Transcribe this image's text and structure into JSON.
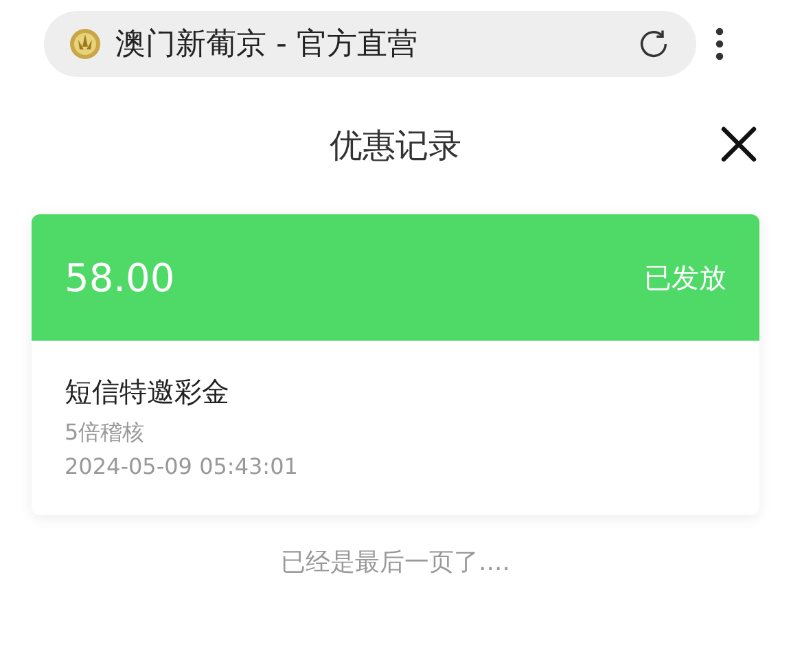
{
  "address_bar": {
    "site_title": "澳门新葡京 - 官方直营"
  },
  "header": {
    "title": "优惠记录"
  },
  "records": [
    {
      "amount": "58.00",
      "status": "已发放",
      "name": "短信特邀彩金",
      "requirement": "5倍稽核",
      "time": "2024-05-09 05:43:01"
    }
  ],
  "footer": "已经是最后一页了...."
}
